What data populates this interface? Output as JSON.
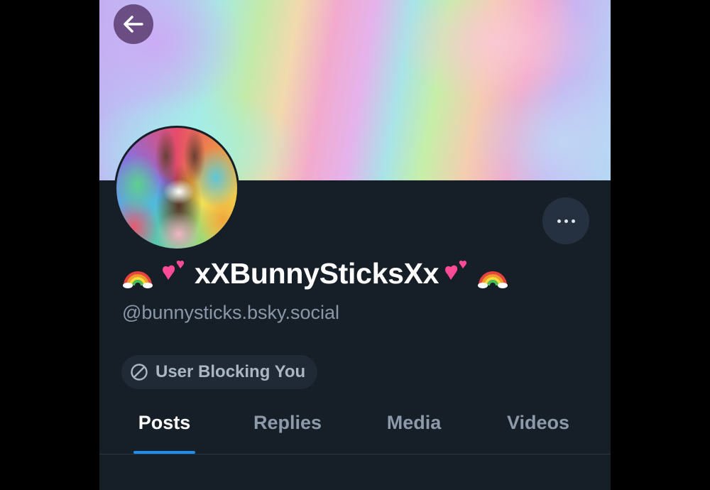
{
  "profile": {
    "display_name": "xXBunnySticksXx",
    "handle": "@bunnysticks.bsky.social",
    "block_status": "User Blocking You",
    "name_emojis": [
      "rainbow-emoji",
      "two-hearts-emoji",
      "two-hearts-emoji",
      "rainbow-emoji"
    ]
  },
  "tabs": [
    {
      "label": "Posts",
      "active": true
    },
    {
      "label": "Replies",
      "active": false
    },
    {
      "label": "Media",
      "active": false
    },
    {
      "label": "Videos",
      "active": false
    }
  ],
  "colors": {
    "background": "#161e27",
    "accent": "#1f8ef1",
    "handle_text": "#8a98a9",
    "pill_background": "#202a36"
  }
}
